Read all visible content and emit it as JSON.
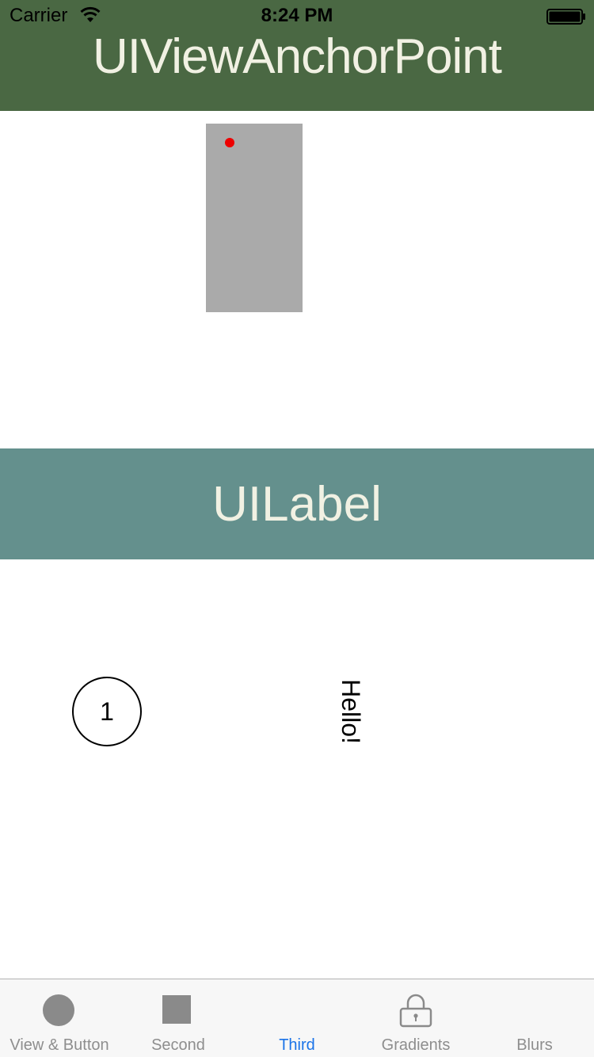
{
  "status_bar": {
    "carrier": "Carrier",
    "time": "8:24 PM"
  },
  "header": {
    "title": "UIViewAnchorPoint",
    "color": "#4a6843"
  },
  "anchor_demo": {
    "view_color": "#aaaaaa",
    "anchor_color": "#ee0000"
  },
  "label_section": {
    "title": "UILabel",
    "color": "#64908d"
  },
  "labels": {
    "circle_text": "1",
    "rotated_text": "Hello!"
  },
  "tab_bar": {
    "selected_color": "#1a73e8",
    "items": [
      {
        "label": "View & Button",
        "icon": "circle-icon"
      },
      {
        "label": "Second",
        "icon": "square-icon"
      },
      {
        "label": "Third",
        "icon": "none",
        "selected": true
      },
      {
        "label": "Gradients",
        "icon": "lock-icon"
      },
      {
        "label": "Blurs",
        "icon": "none"
      }
    ]
  }
}
